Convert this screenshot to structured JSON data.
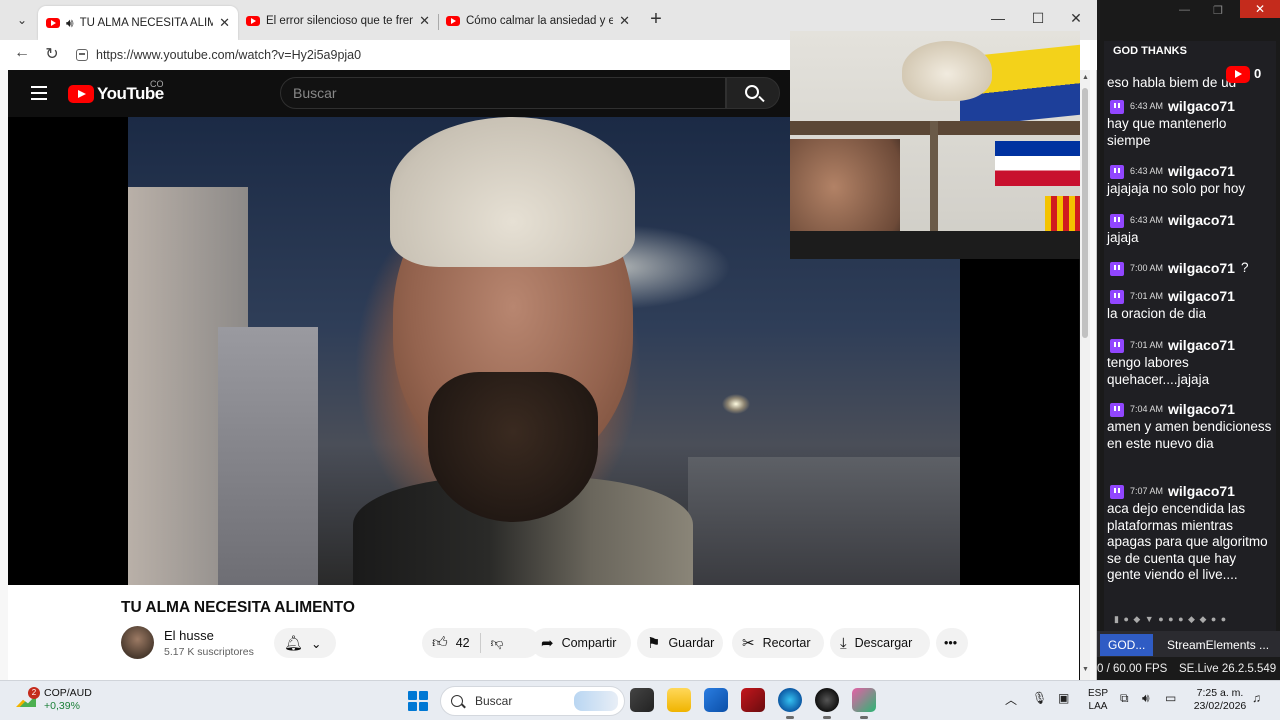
{
  "browser": {
    "tabs": [
      {
        "title": "TU ALMA NECESITA ALIMENTO",
        "active": true,
        "audio": true
      },
      {
        "title": "El error silencioso que te frena y Cómo",
        "active": false
      },
      {
        "title": "Cómo calmar la ansiedad y el ruido",
        "active": false
      }
    ],
    "url": "https://www.youtube.com/watch?v=Hy2i5a9pja0"
  },
  "youtube": {
    "logo_text": "YouTube",
    "country_code": "CO",
    "search_placeholder": "Buscar",
    "video_title": "TU ALMA NECESITA ALIMENTO",
    "channel_name": "El husse",
    "subscribers": "5.17 K suscriptores",
    "likes": "42",
    "share_label": "Compartir",
    "save_label": "Guardar",
    "clip_label": "Recortar",
    "download_label": "Descargar"
  },
  "chat": {
    "title": "GOD THANKS",
    "youtube_viewers": "0",
    "top_partial": "eso habla biem de ud",
    "messages": [
      {
        "time": "6:43 AM",
        "user": "wilgaco71",
        "text": "hay que mantenerlo siempe"
      },
      {
        "time": "6:43 AM",
        "user": "wilgaco71",
        "text": "jajajaja no solo por hoy"
      },
      {
        "time": "6:43 AM",
        "user": "wilgaco71",
        "text": "jajaja"
      },
      {
        "time": "7:00 AM",
        "user": "wilgaco71",
        "text": "?"
      },
      {
        "time": "7:01 AM",
        "user": "wilgaco71",
        "text": "la oracion de dia"
      },
      {
        "time": "7:01 AM",
        "user": "wilgaco71",
        "text": "tengo labores quehacer....jajaja"
      },
      {
        "time": "7:04 AM",
        "user": "wilgaco71",
        "text": "amen y amen bendicioness en este nuevo dia"
      },
      {
        "time": "7:07 AM",
        "user": "wilgaco71",
        "text": "aca dejo encendida las plataformas mientras apagas para que algoritmo se de cuenta que hay gente viendo el live...."
      }
    ]
  },
  "obs": {
    "tab1": "GOD...",
    "tab2": "StreamElements ...",
    "fps": "0 / 60.00 FPS",
    "version": "SE.Live 26.2.5.549"
  },
  "taskbar": {
    "widget_title": "COP/AUD",
    "widget_change": "+0,39%",
    "widget_badge": "2",
    "search_label": "Buscar",
    "lang1": "ESP",
    "lang2": "LAA",
    "time": "7:25 a. m.",
    "date": "23/02/2026"
  },
  "colors": {
    "youtube_red": "#ff0000",
    "twitch_purple": "#9146ff",
    "obs_active_tab": "#2f5cc4"
  }
}
